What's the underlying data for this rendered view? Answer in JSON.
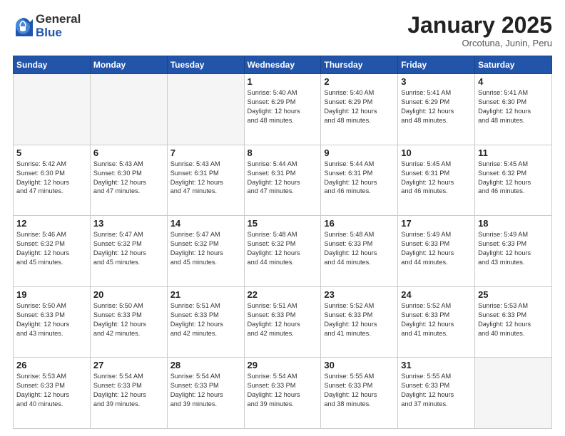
{
  "header": {
    "logo_general": "General",
    "logo_blue": "Blue",
    "month_title": "January 2025",
    "subtitle": "Orcotuna, Junin, Peru"
  },
  "weekdays": [
    "Sunday",
    "Monday",
    "Tuesday",
    "Wednesday",
    "Thursday",
    "Friday",
    "Saturday"
  ],
  "weeks": [
    [
      {
        "day": "",
        "info": ""
      },
      {
        "day": "",
        "info": ""
      },
      {
        "day": "",
        "info": ""
      },
      {
        "day": "1",
        "info": "Sunrise: 5:40 AM\nSunset: 6:29 PM\nDaylight: 12 hours\nand 48 minutes."
      },
      {
        "day": "2",
        "info": "Sunrise: 5:40 AM\nSunset: 6:29 PM\nDaylight: 12 hours\nand 48 minutes."
      },
      {
        "day": "3",
        "info": "Sunrise: 5:41 AM\nSunset: 6:29 PM\nDaylight: 12 hours\nand 48 minutes."
      },
      {
        "day": "4",
        "info": "Sunrise: 5:41 AM\nSunset: 6:30 PM\nDaylight: 12 hours\nand 48 minutes."
      }
    ],
    [
      {
        "day": "5",
        "info": "Sunrise: 5:42 AM\nSunset: 6:30 PM\nDaylight: 12 hours\nand 47 minutes."
      },
      {
        "day": "6",
        "info": "Sunrise: 5:43 AM\nSunset: 6:30 PM\nDaylight: 12 hours\nand 47 minutes."
      },
      {
        "day": "7",
        "info": "Sunrise: 5:43 AM\nSunset: 6:31 PM\nDaylight: 12 hours\nand 47 minutes."
      },
      {
        "day": "8",
        "info": "Sunrise: 5:44 AM\nSunset: 6:31 PM\nDaylight: 12 hours\nand 47 minutes."
      },
      {
        "day": "9",
        "info": "Sunrise: 5:44 AM\nSunset: 6:31 PM\nDaylight: 12 hours\nand 46 minutes."
      },
      {
        "day": "10",
        "info": "Sunrise: 5:45 AM\nSunset: 6:31 PM\nDaylight: 12 hours\nand 46 minutes."
      },
      {
        "day": "11",
        "info": "Sunrise: 5:45 AM\nSunset: 6:32 PM\nDaylight: 12 hours\nand 46 minutes."
      }
    ],
    [
      {
        "day": "12",
        "info": "Sunrise: 5:46 AM\nSunset: 6:32 PM\nDaylight: 12 hours\nand 45 minutes."
      },
      {
        "day": "13",
        "info": "Sunrise: 5:47 AM\nSunset: 6:32 PM\nDaylight: 12 hours\nand 45 minutes."
      },
      {
        "day": "14",
        "info": "Sunrise: 5:47 AM\nSunset: 6:32 PM\nDaylight: 12 hours\nand 45 minutes."
      },
      {
        "day": "15",
        "info": "Sunrise: 5:48 AM\nSunset: 6:32 PM\nDaylight: 12 hours\nand 44 minutes."
      },
      {
        "day": "16",
        "info": "Sunrise: 5:48 AM\nSunset: 6:33 PM\nDaylight: 12 hours\nand 44 minutes."
      },
      {
        "day": "17",
        "info": "Sunrise: 5:49 AM\nSunset: 6:33 PM\nDaylight: 12 hours\nand 44 minutes."
      },
      {
        "day": "18",
        "info": "Sunrise: 5:49 AM\nSunset: 6:33 PM\nDaylight: 12 hours\nand 43 minutes."
      }
    ],
    [
      {
        "day": "19",
        "info": "Sunrise: 5:50 AM\nSunset: 6:33 PM\nDaylight: 12 hours\nand 43 minutes."
      },
      {
        "day": "20",
        "info": "Sunrise: 5:50 AM\nSunset: 6:33 PM\nDaylight: 12 hours\nand 42 minutes."
      },
      {
        "day": "21",
        "info": "Sunrise: 5:51 AM\nSunset: 6:33 PM\nDaylight: 12 hours\nand 42 minutes."
      },
      {
        "day": "22",
        "info": "Sunrise: 5:51 AM\nSunset: 6:33 PM\nDaylight: 12 hours\nand 42 minutes."
      },
      {
        "day": "23",
        "info": "Sunrise: 5:52 AM\nSunset: 6:33 PM\nDaylight: 12 hours\nand 41 minutes."
      },
      {
        "day": "24",
        "info": "Sunrise: 5:52 AM\nSunset: 6:33 PM\nDaylight: 12 hours\nand 41 minutes."
      },
      {
        "day": "25",
        "info": "Sunrise: 5:53 AM\nSunset: 6:33 PM\nDaylight: 12 hours\nand 40 minutes."
      }
    ],
    [
      {
        "day": "26",
        "info": "Sunrise: 5:53 AM\nSunset: 6:33 PM\nDaylight: 12 hours\nand 40 minutes."
      },
      {
        "day": "27",
        "info": "Sunrise: 5:54 AM\nSunset: 6:33 PM\nDaylight: 12 hours\nand 39 minutes."
      },
      {
        "day": "28",
        "info": "Sunrise: 5:54 AM\nSunset: 6:33 PM\nDaylight: 12 hours\nand 39 minutes."
      },
      {
        "day": "29",
        "info": "Sunrise: 5:54 AM\nSunset: 6:33 PM\nDaylight: 12 hours\nand 39 minutes."
      },
      {
        "day": "30",
        "info": "Sunrise: 5:55 AM\nSunset: 6:33 PM\nDaylight: 12 hours\nand 38 minutes."
      },
      {
        "day": "31",
        "info": "Sunrise: 5:55 AM\nSunset: 6:33 PM\nDaylight: 12 hours\nand 37 minutes."
      },
      {
        "day": "",
        "info": ""
      }
    ]
  ]
}
